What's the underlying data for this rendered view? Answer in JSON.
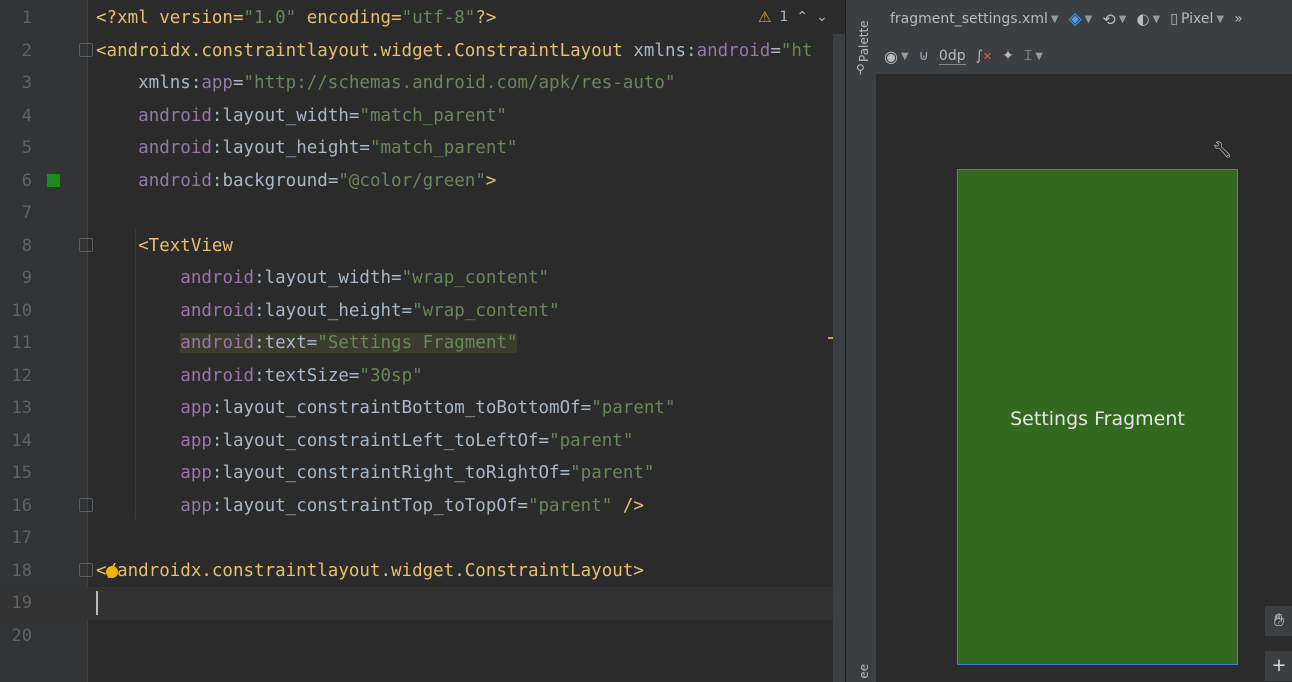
{
  "editor": {
    "warning_count": "1",
    "lines": [
      {
        "no": "1",
        "segments": [
          {
            "t": "<?xml version=",
            "c": "tag"
          },
          {
            "t": "\"1.0\"",
            "c": "str"
          },
          {
            "t": " encoding=",
            "c": "tag"
          },
          {
            "t": "\"utf-8\"",
            "c": "str"
          },
          {
            "t": "?>",
            "c": "tag"
          }
        ]
      },
      {
        "no": "2",
        "segments": [
          {
            "t": "<androidx.constraintlayout.widget.ConstraintLayout ",
            "c": "tag"
          },
          {
            "t": "xmlns:",
            "c": "plain"
          },
          {
            "t": "android",
            "c": "ns"
          },
          {
            "t": "=",
            "c": "plain"
          },
          {
            "t": "\"ht",
            "c": "str"
          }
        ]
      },
      {
        "no": "3",
        "segments": [
          {
            "t": "    xmlns:",
            "c": "plain"
          },
          {
            "t": "app",
            "c": "ns"
          },
          {
            "t": "=",
            "c": "plain"
          },
          {
            "t": "\"http://schemas.android.com/apk/res-auto\"",
            "c": "str"
          }
        ]
      },
      {
        "no": "4",
        "segments": [
          {
            "t": "    ",
            "c": "plain"
          },
          {
            "t": "android",
            "c": "ns"
          },
          {
            "t": ":layout_width=",
            "c": "plain"
          },
          {
            "t": "\"match_parent\"",
            "c": "str"
          }
        ]
      },
      {
        "no": "5",
        "segments": [
          {
            "t": "    ",
            "c": "plain"
          },
          {
            "t": "android",
            "c": "ns"
          },
          {
            "t": ":layout_height=",
            "c": "plain"
          },
          {
            "t": "\"match_parent\"",
            "c": "str"
          }
        ]
      },
      {
        "no": "6",
        "segments": [
          {
            "t": "    ",
            "c": "plain"
          },
          {
            "t": "android",
            "c": "ns"
          },
          {
            "t": ":background=",
            "c": "plain"
          },
          {
            "t": "\"@color/green\"",
            "c": "str"
          },
          {
            "t": ">",
            "c": "tag"
          }
        ]
      },
      {
        "no": "7",
        "segments": []
      },
      {
        "no": "8",
        "segments": [
          {
            "t": "    <TextView",
            "c": "tag"
          }
        ]
      },
      {
        "no": "9",
        "segments": [
          {
            "t": "        ",
            "c": "plain"
          },
          {
            "t": "android",
            "c": "ns"
          },
          {
            "t": ":layout_width=",
            "c": "plain"
          },
          {
            "t": "\"wrap_content\"",
            "c": "str"
          }
        ]
      },
      {
        "no": "10",
        "segments": [
          {
            "t": "        ",
            "c": "plain"
          },
          {
            "t": "android",
            "c": "ns"
          },
          {
            "t": ":layout_height=",
            "c": "plain"
          },
          {
            "t": "\"wrap_content\"",
            "c": "str"
          }
        ]
      },
      {
        "no": "11",
        "segments": [
          {
            "t": "        ",
            "c": "plain"
          },
          {
            "t": "android",
            "c": "ns hl"
          },
          {
            "t": ":text=",
            "c": "plain hl"
          },
          {
            "t": "\"Settings Fragment\"",
            "c": "str hl"
          }
        ]
      },
      {
        "no": "12",
        "segments": [
          {
            "t": "        ",
            "c": "plain"
          },
          {
            "t": "android",
            "c": "ns"
          },
          {
            "t": ":textSize=",
            "c": "plain"
          },
          {
            "t": "\"30sp\"",
            "c": "str"
          }
        ]
      },
      {
        "no": "13",
        "segments": [
          {
            "t": "        ",
            "c": "plain"
          },
          {
            "t": "app",
            "c": "ns"
          },
          {
            "t": ":layout_constraintBottom_toBottomOf=",
            "c": "plain"
          },
          {
            "t": "\"parent\"",
            "c": "str"
          }
        ]
      },
      {
        "no": "14",
        "segments": [
          {
            "t": "        ",
            "c": "plain"
          },
          {
            "t": "app",
            "c": "ns"
          },
          {
            "t": ":layout_constraintLeft_toLeftOf=",
            "c": "plain"
          },
          {
            "t": "\"parent\"",
            "c": "str"
          }
        ]
      },
      {
        "no": "15",
        "segments": [
          {
            "t": "        ",
            "c": "plain"
          },
          {
            "t": "app",
            "c": "ns"
          },
          {
            "t": ":layout_constraintRight_toRightOf=",
            "c": "plain"
          },
          {
            "t": "\"parent\"",
            "c": "str"
          }
        ]
      },
      {
        "no": "16",
        "segments": [
          {
            "t": "        ",
            "c": "plain"
          },
          {
            "t": "app",
            "c": "ns"
          },
          {
            "t": ":layout_constraintTop_toTopOf=",
            "c": "plain"
          },
          {
            "t": "\"parent\"",
            "c": "str"
          },
          {
            "t": " />",
            "c": "tag"
          }
        ]
      },
      {
        "no": "17",
        "segments": []
      },
      {
        "no": "18",
        "segments": [
          {
            "t": "</androidx.constraintlayout.widget.ConstraintLayout>",
            "c": "tag"
          }
        ]
      },
      {
        "no": "19",
        "segments": []
      },
      {
        "no": "20",
        "segments": []
      }
    ],
    "current_line": "19"
  },
  "side_strip": {
    "palette_label": "Palette",
    "tree_label": "ee"
  },
  "designer": {
    "file_name": "fragment_settings.xml",
    "device": "Pixel",
    "margin_value": "0dp",
    "preview_text": "Settings Fragment",
    "preview_bg": "#33691e"
  },
  "icons": {
    "warning": "warning-triangle-icon",
    "prev": "chevron-up-icon",
    "next": "chevron-down-icon",
    "layers": "layers-icon",
    "orientation": "rotate-icon",
    "theme": "theme-icon",
    "device": "phone-icon",
    "overflow": "double-chevron-right-icon",
    "eye": "eye-icon",
    "magnet": "magnet-off-icon",
    "constraints": "clear-constraints-icon",
    "infer": "magic-wand-icon",
    "guidelines": "align-icon",
    "wrench": "wrench-icon",
    "pan": "hand-icon",
    "zoom_in": "plus-icon"
  }
}
